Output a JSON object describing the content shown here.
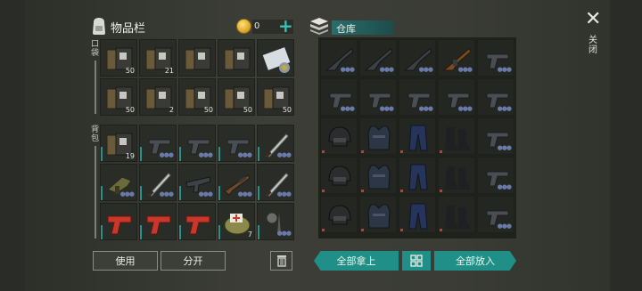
{
  "inventory": {
    "title": "物品栏",
    "icon": "backpack-icon",
    "coins": "0",
    "pocket_label": "口袋",
    "backpack_label": "背包",
    "rows": [
      [
        {
          "icon": "book-icon",
          "count": "50"
        },
        {
          "icon": "book-icon",
          "count": "21"
        },
        {
          "icon": "book-icon",
          "count": ""
        },
        {
          "icon": "book-icon",
          "count": ""
        },
        {
          "icon": "map-scroll-icon",
          "count": ""
        }
      ],
      [
        {
          "icon": "book-icon",
          "count": "50"
        },
        {
          "icon": "book-icon",
          "count": "2"
        },
        {
          "icon": "book-icon",
          "count": "50"
        },
        {
          "icon": "book-icon",
          "count": "50"
        },
        {
          "icon": "book-icon",
          "count": "50"
        }
      ],
      [
        {
          "icon": "book-icon",
          "count": "19"
        },
        {
          "icon": "pistol-icon",
          "count": ""
        },
        {
          "icon": "pistol-icon",
          "count": ""
        },
        {
          "icon": "pistol-icon",
          "count": ""
        },
        {
          "icon": "sword-icon",
          "count": ""
        }
      ],
      [
        {
          "icon": "grenade-launcher-icon",
          "count": ""
        },
        {
          "icon": "sword-icon",
          "count": ""
        },
        {
          "icon": "smg-icon",
          "count": ""
        },
        {
          "icon": "shotgun-icon",
          "count": ""
        },
        {
          "icon": "sword-icon",
          "count": ""
        }
      ],
      [
        {
          "icon": "flare-gun-icon",
          "count": ""
        },
        {
          "icon": "flare-gun-icon",
          "count": ""
        },
        {
          "icon": "flare-gun-icon",
          "count": ""
        },
        {
          "icon": "medkit-bag-icon",
          "count": "7"
        },
        {
          "icon": "flail-icon",
          "count": ""
        }
      ]
    ]
  },
  "warehouse": {
    "title": "仓库",
    "icon": "warehouse-box-icon",
    "rows": [
      [
        "rifle-icon",
        "rifle-icon",
        "rifle-icon",
        "ak-rifle-icon",
        "pistol-icon"
      ],
      [
        "pistol-icon",
        "pistol-icon",
        "pistol-icon",
        "pistol-icon",
        "pistol-icon"
      ],
      [
        "helmet-icon",
        "armor-vest-icon",
        "pants-icon",
        "boots-icon",
        "pistol-icon"
      ],
      [
        "helmet-icon",
        "armor-vest-icon",
        "pants-icon",
        "boots-icon",
        "pistol-icon"
      ],
      [
        "helmet-icon",
        "armor-vest-icon",
        "pants-icon",
        "boots-icon",
        "pistol-icon"
      ]
    ]
  },
  "close": {
    "label": "关闭"
  },
  "buttons": {
    "use": "使用",
    "split": "分开",
    "take_all": "全部拿上",
    "put_all": "全部放入"
  },
  "colors": {
    "accent": "#1f8f88",
    "coin": "#d4a020"
  }
}
